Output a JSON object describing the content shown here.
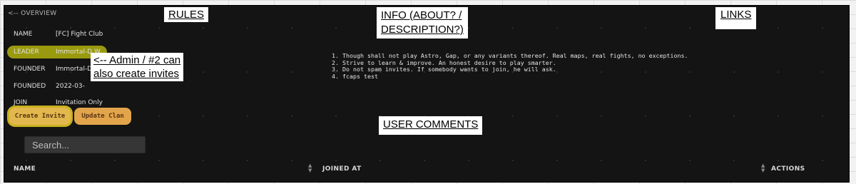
{
  "overview": {
    "back_link": "<-- OVERVIEW"
  },
  "clan_info": {
    "rows": [
      {
        "label": "NAME",
        "value": "[FC] Fight Club"
      },
      {
        "label": "LEADER",
        "value": "Immortal-D.W."
      },
      {
        "label": "FOUNDER",
        "value": "Immortal-D"
      },
      {
        "label": "FOUNDED",
        "value": "2022-03-"
      },
      {
        "label": "JOIN",
        "value": "Invitation Only"
      }
    ]
  },
  "actions": {
    "create_invite": "Create Invite",
    "update_clan": "Update Clan"
  },
  "search": {
    "placeholder": "Search..."
  },
  "rules": [
    "1. Though shall not play Astro, Gap, or any variants thereof.  Real maps, real fights, no exceptions.",
    "2. Strive to learn & improve.  An honest desire to play smarter.",
    "3. Do not spam invites.  If somebody wants to join, he will ask.",
    "4. fcaps test"
  ],
  "table": {
    "columns": [
      "NAME",
      "JOINED AT",
      "ACTIONS"
    ]
  },
  "annotations": {
    "rules": "RULES",
    "info_line1": "INFO (ABOUT? /",
    "info_line2": "DESCRIPTION?)",
    "links": "LINKS",
    "admin_line1": "<-- Admin / #2 can",
    "admin_line2": "also create invites",
    "user_comments": "USER COMMENTS"
  },
  "colors": {
    "panel_bg": "#141414",
    "button": "#e3a54b",
    "highlight": "#c9b11e"
  }
}
